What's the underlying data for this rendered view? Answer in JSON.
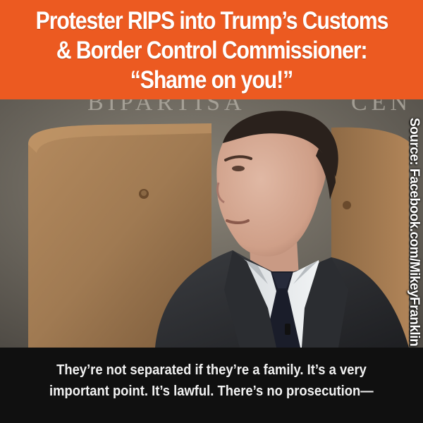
{
  "headline": {
    "lines": [
      "Protester RIPS into Trump’s Customs",
      "& Border Control Commissioner:",
      "“Shame on you!”"
    ],
    "background_color": "#ec5a21",
    "text_color": "#ffffff"
  },
  "video": {
    "backdrop_text_left": "BIPARTISA",
    "backdrop_text_right": "CEN",
    "source_credit": "Source: Facebook.com/MikeyFranklin"
  },
  "caption": {
    "lines": [
      "They’re not separated if they’re a family. It’s a very",
      "important point. It’s lawful. There’s no prosecution—"
    ]
  }
}
